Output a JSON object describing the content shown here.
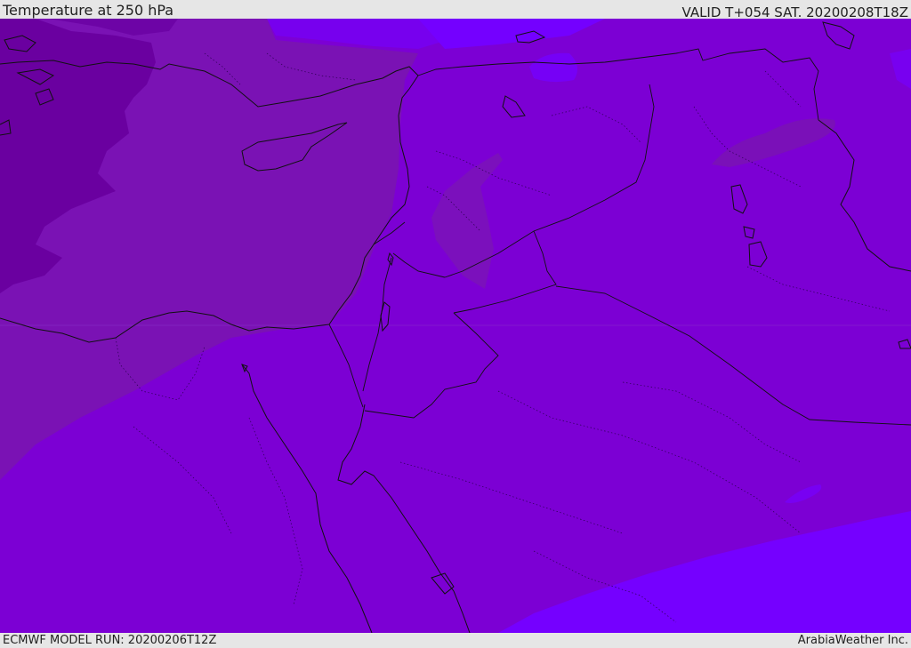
{
  "header": {
    "title": "Temperature at 250 hPa",
    "valid": "VALID T+054 SAT. 20200208T18Z"
  },
  "footer": {
    "model_run": "ECMWF MODEL RUN: 20200206T12Z",
    "credit": "ArabiaWeather Inc."
  },
  "map": {
    "variable": "temperature",
    "level": "250 hPa",
    "colors": {
      "band_coldest": "#6a00a0",
      "band_cold": "#7a12b4",
      "band_mid": "#7c00d4",
      "band_warm": "#7500ff",
      "border": "#111111"
    }
  }
}
